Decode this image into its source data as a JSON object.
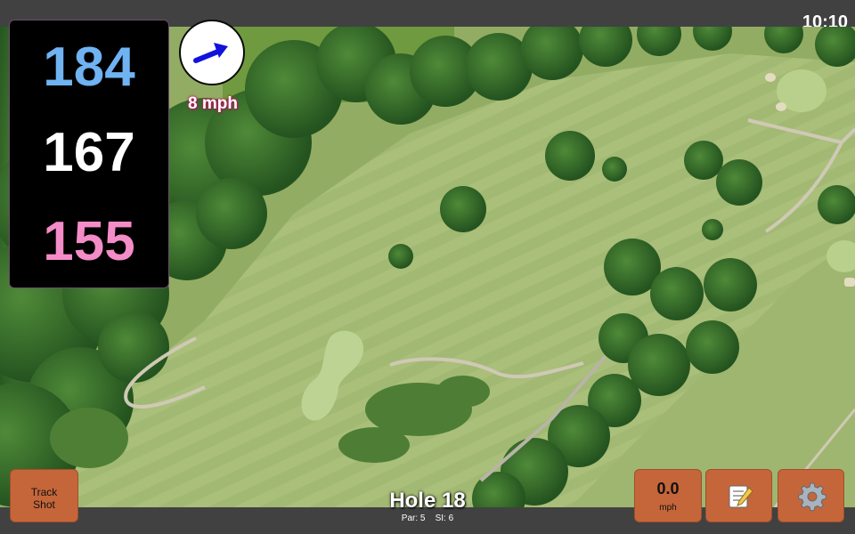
{
  "clock": "10:10",
  "distances": {
    "back": "184",
    "middle": "167",
    "front": "155"
  },
  "colors": {
    "back": "#6fb3f2",
    "middle": "#ffffff",
    "front": "#f48cc8",
    "arrow": "#1212dd",
    "button": "#c5663a"
  },
  "wind": {
    "speed_label": "8 mph",
    "icon": "wind-arrow-icon"
  },
  "buttons": {
    "track_shot": {
      "line1": "Track",
      "line2": "Shot"
    },
    "speed": {
      "value": "0.0",
      "unit": "mph"
    },
    "notes_icon": "notepad-icon",
    "settings_icon": "gear-icon"
  },
  "hole": {
    "title": "Hole 18",
    "par": "Par: 5",
    "si": "SI: 6"
  }
}
